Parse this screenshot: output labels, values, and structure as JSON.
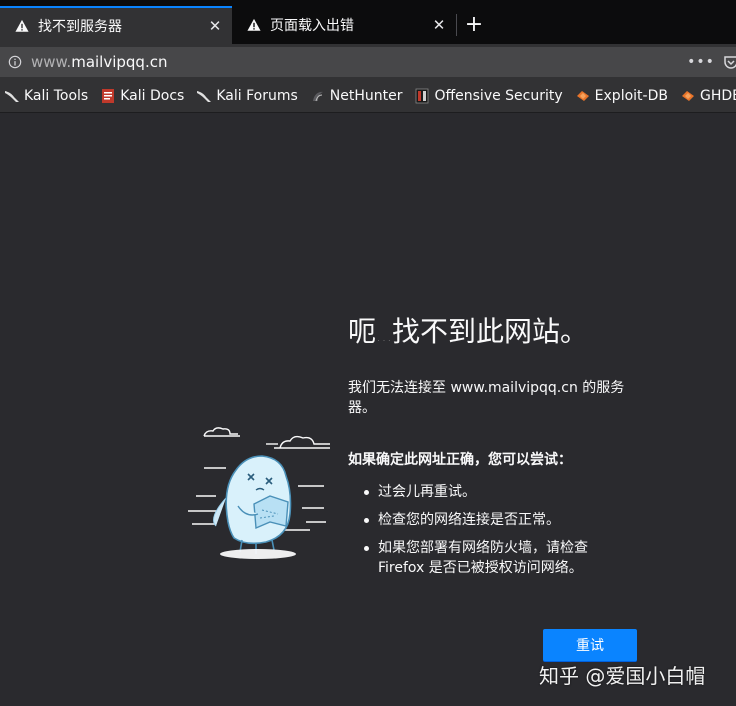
{
  "tabs": [
    {
      "title": "找不到服务器",
      "close": "✕",
      "active": true,
      "icon": "warning-icon"
    },
    {
      "title": "页面载入出错",
      "close": "✕",
      "active": false,
      "icon": "warning-icon"
    }
  ],
  "new_tab": "+",
  "urlbar": {
    "url_prefix": "www.",
    "url_host": "mailvipqq.cn",
    "more_actions": "•••"
  },
  "bookmarks": [
    {
      "label": "Kali Tools",
      "icon": "kali-dragon-icon"
    },
    {
      "label": "Kali Docs",
      "icon": "kali-docs-icon"
    },
    {
      "label": "Kali Forums",
      "icon": "kali-dragon-icon"
    },
    {
      "label": "NetHunter",
      "icon": "nethunter-icon"
    },
    {
      "label": "Offensive Security",
      "icon": "offsec-icon"
    },
    {
      "label": "Exploit-DB",
      "icon": "exploit-db-icon"
    },
    {
      "label": "GHDB",
      "icon": "ghdb-icon"
    }
  ],
  "error": {
    "title": "找不到此网站。",
    "title_prefix": "呃",
    "title_ellipsis": "…",
    "description": "我们无法连接至 www.mailvipqq.cn 的服务器。",
    "suggest_heading": "如果确定此网址正确，您可以尝试：",
    "suggestions": [
      "过会儿再重试。",
      "检查您的网络连接是否正常。",
      "如果您部署有网络防火墙，请检查 Firefox 是否已被授权访问网络。"
    ],
    "retry_label": "重试"
  },
  "watermark": "知乎 @爱国小白帽",
  "colors": {
    "accent": "#0a84ff",
    "page_bg": "#2a2a2e",
    "toolbar_bg": "#323234",
    "tabstrip_bg": "#0c0c0d"
  }
}
